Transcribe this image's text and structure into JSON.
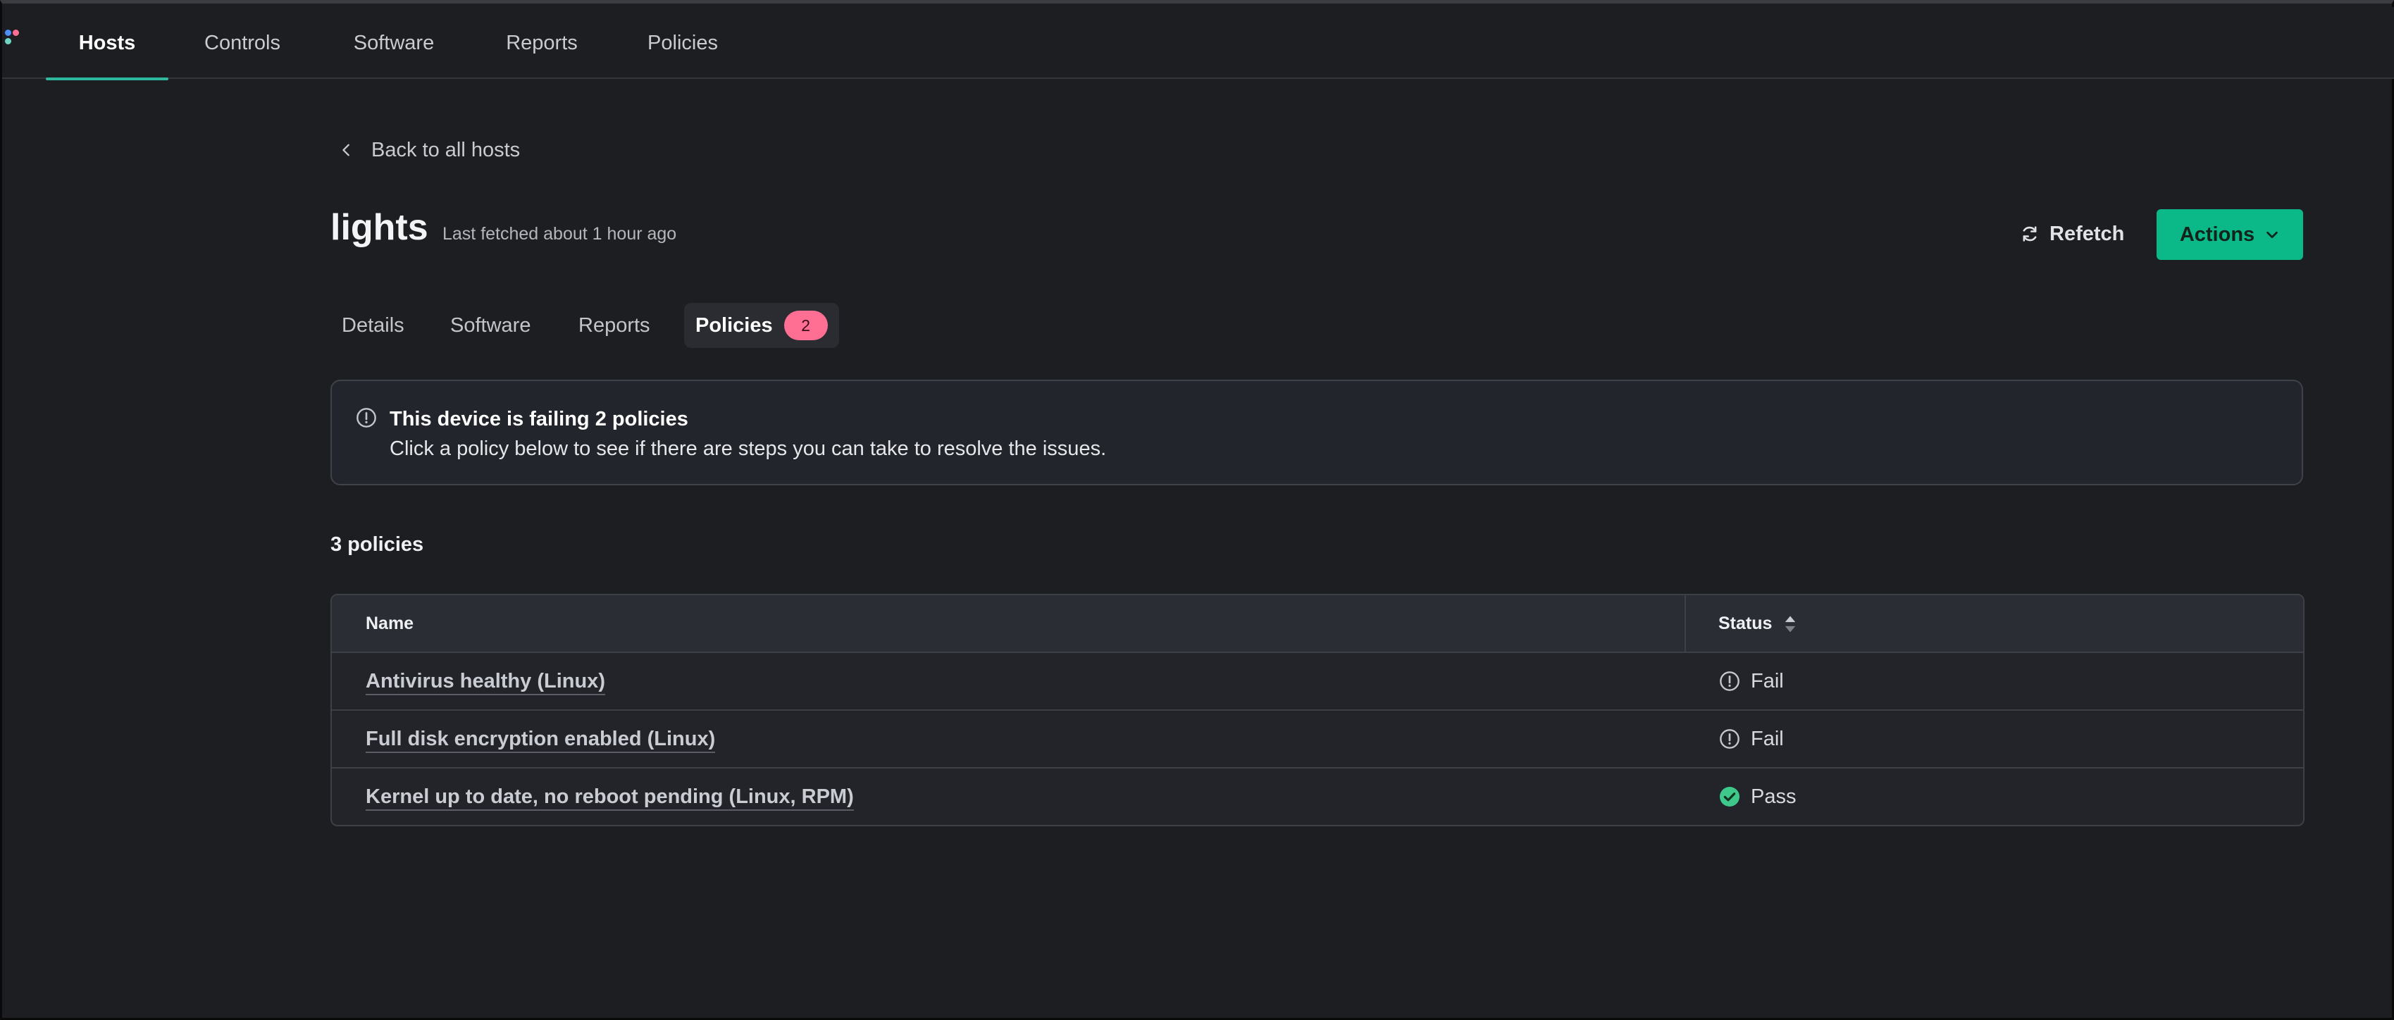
{
  "colors": {
    "background": "#1d1e22",
    "accent": "#0bb887",
    "active_underline": "#2fb8a0",
    "badge": "#ff6f93",
    "pass": "#3ec98b",
    "fail": "#c4c6cb"
  },
  "topnav": {
    "items": [
      {
        "label": "Hosts",
        "active": true
      },
      {
        "label": "Controls"
      },
      {
        "label": "Software"
      },
      {
        "label": "Reports"
      },
      {
        "label": "Policies"
      }
    ]
  },
  "back_link": {
    "label": "Back to all hosts",
    "icon": "chevron-left-icon"
  },
  "host": {
    "name": "lights",
    "last_fetched": "Last fetched about 1 hour ago"
  },
  "header_actions": {
    "refetch_label": "Refetch",
    "refetch_icon": "refresh-icon",
    "actions_label": "Actions",
    "actions_icon": "chevron-down-icon"
  },
  "tabs": [
    {
      "label": "Details"
    },
    {
      "label": "Software"
    },
    {
      "label": "Reports"
    },
    {
      "label": "Policies",
      "active": true,
      "badge": "2"
    }
  ],
  "alert": {
    "icon": "exclamation-circle-icon",
    "title": "This device is failing 2 policies",
    "message": "Click a policy below to see if there are steps you can take to resolve the issues."
  },
  "policies": {
    "count_label": "3 policies",
    "columns": {
      "name": "Name",
      "status": "Status"
    },
    "rows": [
      {
        "name": "Antivirus healthy (Linux)",
        "status": "Fail",
        "status_icon": "exclamation-circle-icon"
      },
      {
        "name": "Full disk encryption enabled (Linux)",
        "status": "Fail",
        "status_icon": "exclamation-circle-icon"
      },
      {
        "name": "Kernel up to date, no reboot pending (Linux, RPM)",
        "status": "Pass",
        "status_icon": "check-circle-icon"
      }
    ]
  }
}
